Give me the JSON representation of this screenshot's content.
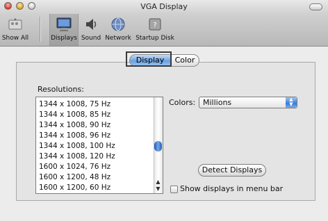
{
  "window": {
    "title": "VGA Display"
  },
  "toolbar": {
    "items": [
      {
        "label": "Show All",
        "icon": "show-all-icon"
      },
      {
        "label": "Displays",
        "icon": "display-icon",
        "selected": true
      },
      {
        "label": "Sound",
        "icon": "speaker-icon"
      },
      {
        "label": "Network",
        "icon": "globe-icon"
      },
      {
        "label": "Startup Disk",
        "icon": "disk-icon"
      }
    ]
  },
  "tabs": [
    {
      "label": "Display",
      "selected": true
    },
    {
      "label": "Color",
      "selected": false
    }
  ],
  "resolutions": {
    "label": "Resolutions:",
    "items": [
      "1344 x 1008, 75 Hz",
      "1344 x 1008, 85 Hz",
      "1344 x 1008, 90 Hz",
      "1344 x 1008, 96 Hz",
      "1344 x 1008, 100 Hz",
      "1344 x 1008, 120 Hz",
      "1600 x 1024, 76 Hz",
      "1600 x 1200, 48 Hz",
      "1600 x 1200, 60 Hz"
    ]
  },
  "colors": {
    "label": "Colors:",
    "value": "Millions"
  },
  "detect_button": "Detect Displays",
  "menu_bar_checkbox": {
    "label": "Show displays in menu bar",
    "checked": false
  },
  "accent": "#5b95dd"
}
